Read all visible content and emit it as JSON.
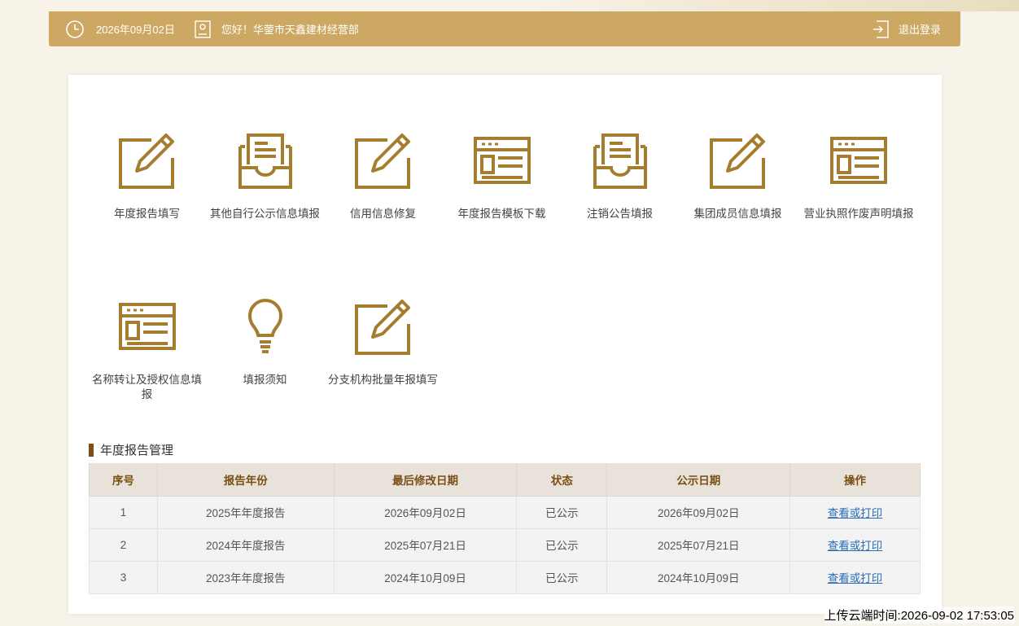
{
  "header": {
    "date": "2026年09月02日",
    "greeting": "您好！华蓥市天鑫建材经营部",
    "logout_label": "退出登录"
  },
  "tiles": [
    {
      "label": "年度报告填写",
      "icon": "edit-icon"
    },
    {
      "label": "其他自行公示信息填报",
      "icon": "inbox-icon"
    },
    {
      "label": "信用信息修复",
      "icon": "edit-icon"
    },
    {
      "label": "年度报告模板下载",
      "icon": "template-icon"
    },
    {
      "label": "注销公告填报",
      "icon": "inbox-icon"
    },
    {
      "label": "集团成员信息填报",
      "icon": "edit-icon"
    },
    {
      "label": "营业执照作废声明填报",
      "icon": "template-icon"
    },
    {
      "label": "名称转让及授权信息填报",
      "icon": "template-icon"
    },
    {
      "label": "填报须知",
      "icon": "lightbulb-icon"
    },
    {
      "label": "分支机构批量年报填写",
      "icon": "edit-icon"
    }
  ],
  "section": {
    "title": "年度报告管理"
  },
  "table": {
    "headers": [
      "序号",
      "报告年份",
      "最后修改日期",
      "状态",
      "公示日期",
      "操作"
    ],
    "rows": [
      [
        "1",
        "2025年年度报告",
        "2026年09月02日",
        "已公示",
        "2026年09月02日",
        "查看或打印"
      ],
      [
        "2",
        "2024年年度报告",
        "2025年07月21日",
        "已公示",
        "2025年07月21日",
        "查看或打印"
      ],
      [
        "3",
        "2023年年度报告",
        "2024年10月09日",
        "已公示",
        "2024年10月09日",
        "查看或打印"
      ]
    ]
  },
  "upload_time": "上传云端时间:2026-09-02 17:53:05",
  "colors": {
    "accent": "#cda863",
    "icon": "#a57d2e",
    "header_text": "#7a4f12",
    "link": "#2a6eb5"
  }
}
